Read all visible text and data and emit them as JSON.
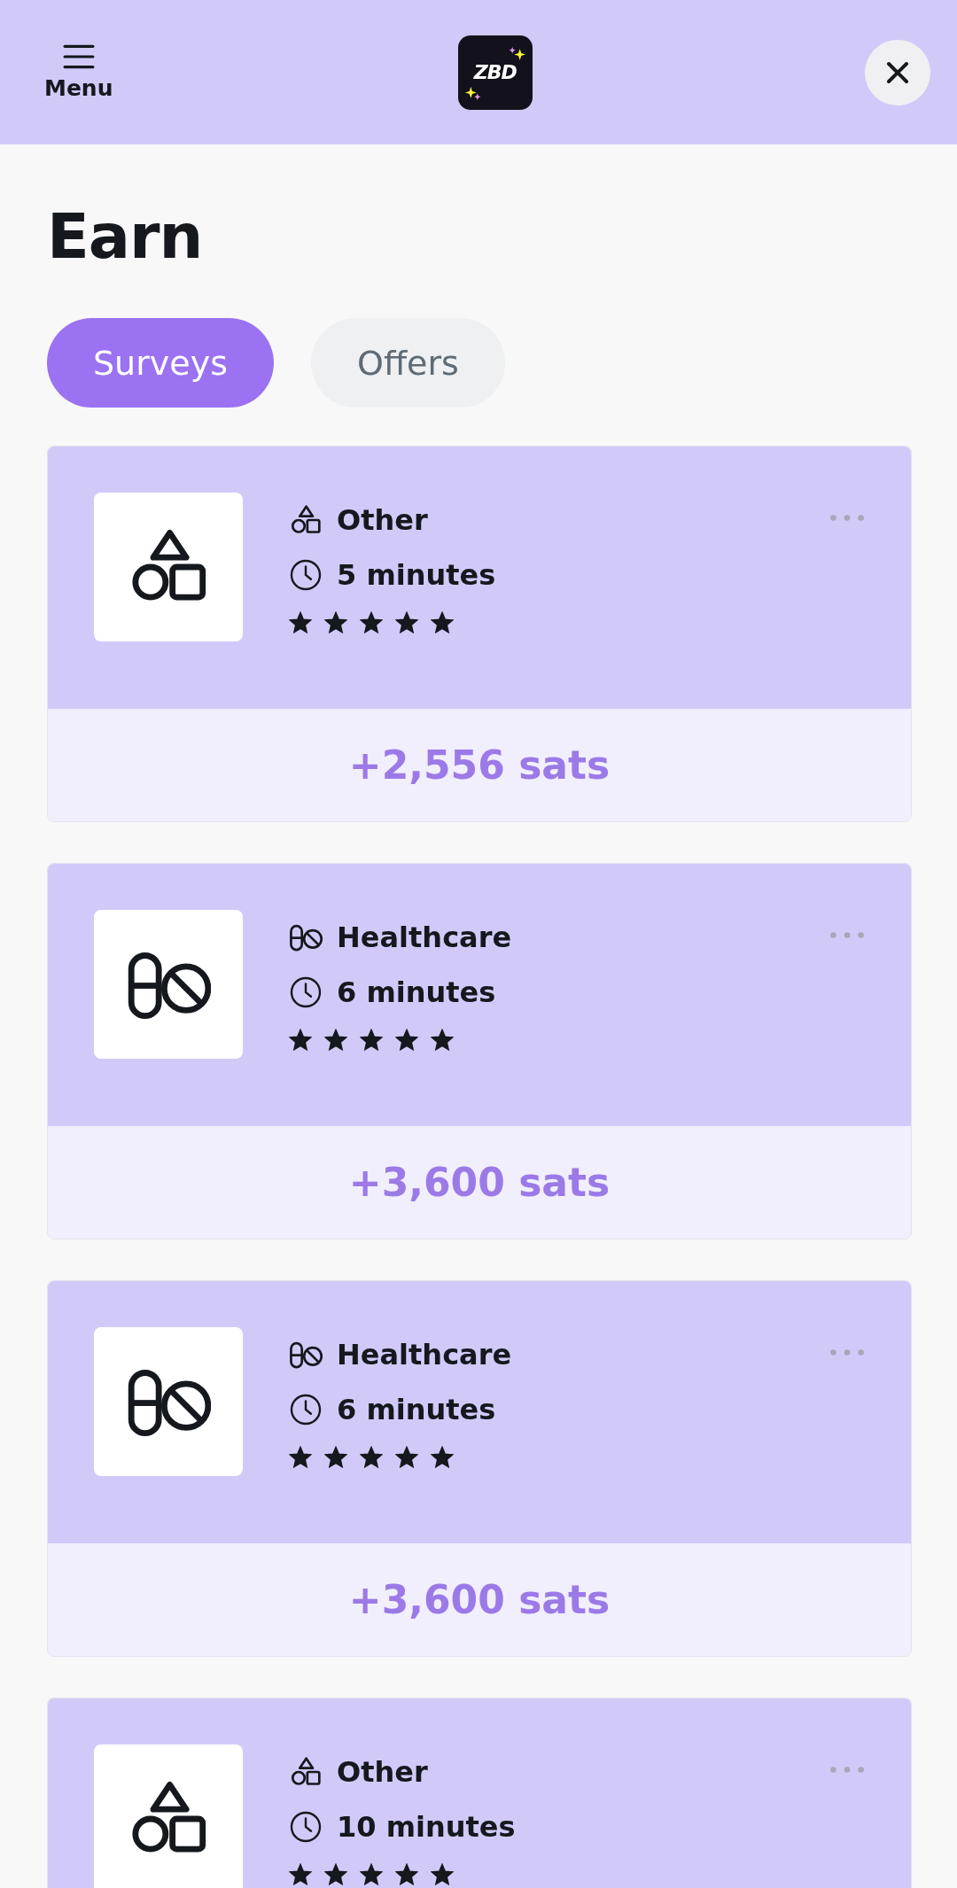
{
  "header": {
    "menu_label": "Menu",
    "logo_text": "ZBD"
  },
  "title": "Earn",
  "tabs": [
    {
      "label": "Surveys",
      "selected": true
    },
    {
      "label": "Offers",
      "selected": false
    }
  ],
  "surveys": [
    {
      "kind": "other",
      "category": "Other",
      "duration": "5 minutes",
      "stars": 5,
      "reward": "+2,556 sats"
    },
    {
      "kind": "healthcare",
      "category": "Healthcare",
      "duration": "6 minutes",
      "stars": 5,
      "reward": "+3,600 sats"
    },
    {
      "kind": "healthcare",
      "category": "Healthcare",
      "duration": "6 minutes",
      "stars": 5,
      "reward": "+3,600 sats"
    },
    {
      "kind": "other",
      "category": "Other",
      "duration": "10 minutes",
      "stars": 5
    }
  ]
}
